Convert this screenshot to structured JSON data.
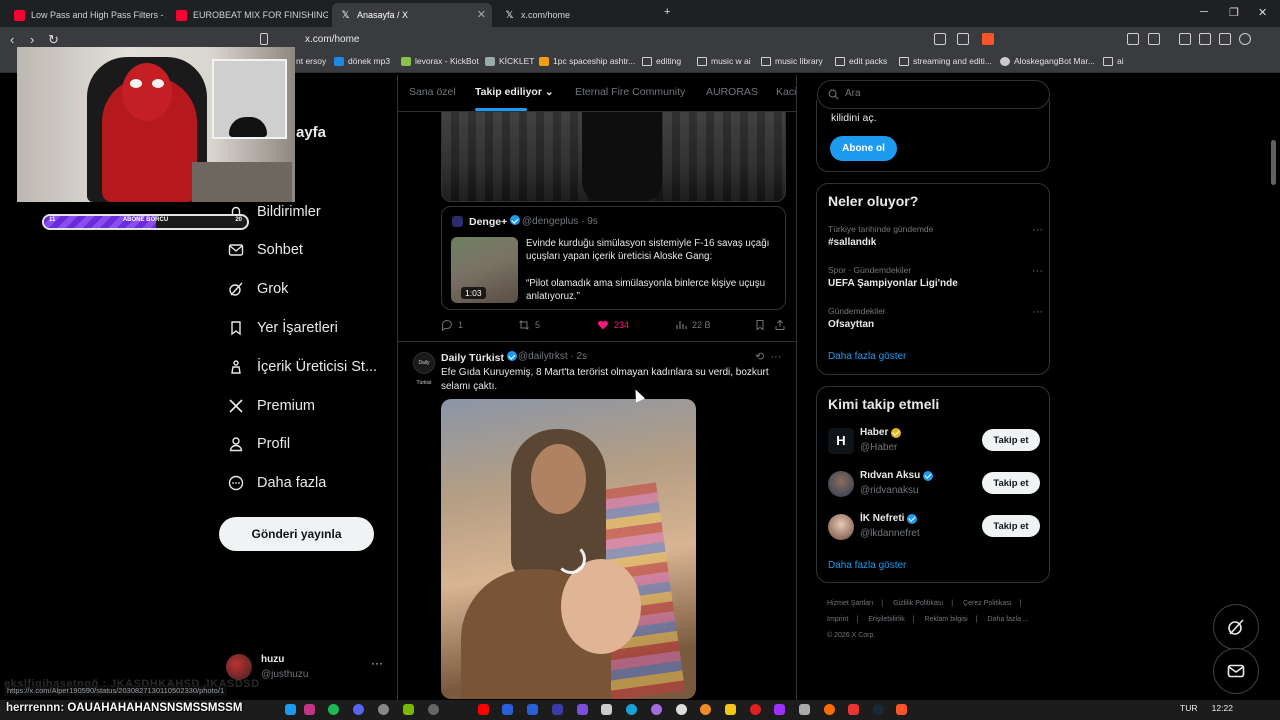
{
  "browser": {
    "tabs": [
      {
        "title": "Low Pass and High Pass Filters - Adob",
        "icon": "youtube-icon"
      },
      {
        "title": "EUROBEAT MIX FOR FINISHING SCH",
        "icon": "youtube-icon"
      },
      {
        "title": "Anasayfa / X",
        "icon": "x-icon",
        "active": true
      },
      {
        "title": "x.com/home",
        "icon": "x-icon"
      }
    ],
    "url": "x.com/home",
    "bookmarks": [
      {
        "label": "nt ersoy",
        "icon": "folder-icon"
      },
      {
        "label": "dönek mp3",
        "icon": "app-icon"
      },
      {
        "label": "levorax - KickBot",
        "icon": "kickbot-icon"
      },
      {
        "label": "KİCKLET",
        "icon": "kicklet-icon"
      },
      {
        "label": "1pc spaceship ashtr...",
        "icon": "shop-icon"
      },
      {
        "label": "editing",
        "icon": "folder-icon"
      },
      {
        "label": "music w ai",
        "icon": "folder-icon"
      },
      {
        "label": "music library",
        "icon": "folder-icon"
      },
      {
        "label": "edit packs",
        "icon": "folder-icon"
      },
      {
        "label": "streaming and editi...",
        "icon": "folder-icon"
      },
      {
        "label": "AloskegangBot Mar...",
        "icon": "bot-icon"
      },
      {
        "label": "ai",
        "icon": "folder-icon"
      }
    ]
  },
  "overlay": {
    "sub_goal_label": "ABONE BORCU",
    "sub_goal_left": "11",
    "sub_goal_right": "20",
    "sub_goal_progress": 0.55
  },
  "nav": {
    "home_label_fragment": "ayfa",
    "items": [
      {
        "label": "Bildirimler",
        "icon": "bell-icon"
      },
      {
        "label": "Sohbet",
        "icon": "mail-icon"
      },
      {
        "label": "Grok",
        "icon": "grok-icon"
      },
      {
        "label": "Yer İşaretleri",
        "icon": "bookmark-icon"
      },
      {
        "label": "İçerik Üreticisi St...",
        "icon": "creator-icon"
      },
      {
        "label": "Premium",
        "icon": "x-logo-icon"
      },
      {
        "label": "Profil",
        "icon": "profile-icon"
      },
      {
        "label": "Daha fazla",
        "icon": "more-circle-icon"
      }
    ],
    "post_button": "Gönderi yayınla",
    "account": {
      "name": "huzu",
      "handle": "@justhuzu",
      "more": "···"
    }
  },
  "timeline": {
    "tabs": [
      "Sana özel",
      "Takip ediliyor",
      "Eternal Fire Community",
      "AURORAS",
      "Kaci"
    ],
    "active_tab": "Takip ediliyor",
    "quote": {
      "name": "Denge+",
      "handle_time": "@dengeplus · 9s",
      "video_duration": "1:03",
      "text": "Evinde kurduğu simülasyon sistemiyle F-16 savaş uçağı uçuşları yapan içerik üreticisi Aloske Gang:",
      "text2": "“Pilot olamadık ama simülasyonla binlerce kişiye uçuşu anlatıyoruz.”"
    },
    "tweet1_actions": {
      "replies": "1",
      "reposts": "5",
      "likes": "234",
      "views": "22 B"
    },
    "tweet2": {
      "name": "Daily Türkist",
      "handle_time": "@dailytrkst · 2s",
      "avatar_text": "Daily Türkist",
      "text": "Efe Gıda Kuruyemiş, 8 Mart'ta terörist olmayan kadınlara su verdi, bozkurt selamı çaktı."
    }
  },
  "sidebar": {
    "search_placeholder": "Ara",
    "premium_text": "kilidini aç.",
    "premium_button": "Abone ol",
    "trends_title": "Neler oluyor?",
    "trends": [
      {
        "context": "Türkiye tarihinde gündemde",
        "name": "#sallandık"
      },
      {
        "context": "Spor · Gündemdekiler",
        "name": "UEFA Şampiyonlar Ligi'nde"
      },
      {
        "context": "Gündemdekiler",
        "name": "Ofsayttan"
      }
    ],
    "trends_more": "Daha fazla göster",
    "wtf_title": "Kimi takip etmeli",
    "who_to_follow": [
      {
        "name": "Haber",
        "handle": "@Haber",
        "badge": "gold",
        "button": "Takip et"
      },
      {
        "name": "Rıdvan Aksu",
        "handle": "@ridvanaksu",
        "badge": "blue",
        "button": "Takip et"
      },
      {
        "name": "İK Nefreti",
        "handle": "@lkdannefret",
        "badge": "blue",
        "button": "Takip et"
      }
    ],
    "wtf_more": "Daha fazla göster",
    "footer": [
      "Hizmet Şartları",
      "|",
      "Gizlilik Politikası",
      "|",
      "Çerez Politikası",
      "|",
      "Imprint",
      "|",
      "Erişilebilirlik",
      "|",
      "Reklam bilgisi",
      "|",
      "Daha fazla ...",
      "© 2026 X Corp."
    ]
  },
  "status": {
    "link_preview": "https://x.com/Alper190590/status/2030827130110502330/photo/1",
    "ghost_text": "ekslfigjhasetngğ : JKASDHKAHSD JKASDSD",
    "chat_user": "herrrennn:",
    "chat_message": "OAUAHAHAHANSNSMSSMSSM",
    "tray_lang": "TUR",
    "clock": "12:22"
  },
  "colors": {
    "accent": "#1d9bf0",
    "like": "#f91880",
    "background": "#000000",
    "border": "#2f3336"
  }
}
